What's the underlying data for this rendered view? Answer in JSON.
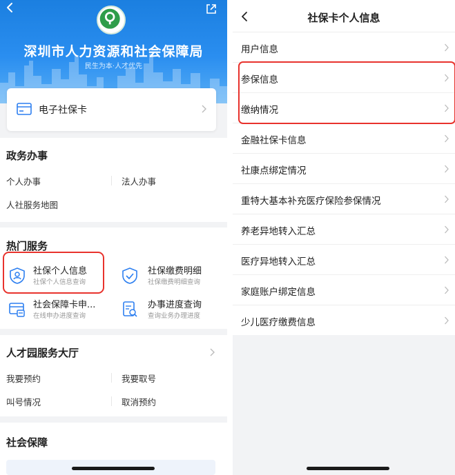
{
  "left": {
    "header": {
      "title": "深圳市人力资源和社会保障局",
      "subtitle": "民生为本·人才优先"
    },
    "e_card": {
      "label": "电子社保卡"
    },
    "gov_services": {
      "title": "政务办事",
      "items": [
        "个人办事",
        "法人办事",
        "人社服务地图"
      ]
    },
    "hot_services": {
      "title": "热门服务",
      "items": [
        {
          "title": "社保个人信息",
          "subtitle": "社保个人信息查询",
          "icon": "user-shield-icon"
        },
        {
          "title": "社保缴费明细",
          "subtitle": "社保缴费明细查询",
          "icon": "check-shield-icon"
        },
        {
          "title": "社会保障卡申...",
          "subtitle": "在线申办进度查询",
          "icon": "card-apply-icon"
        },
        {
          "title": "办事进度查询",
          "subtitle": "查询业务办理进度",
          "icon": "progress-query-icon"
        }
      ]
    },
    "talent_hall": {
      "title": "人才园服务大厅",
      "items": [
        "我要预约",
        "我要取号",
        "叫号情况",
        "取消预约"
      ]
    },
    "social_security": {
      "title": "社会保障"
    }
  },
  "right": {
    "header": {
      "title": "社保卡个人信息"
    },
    "rows": [
      "用户信息",
      "参保信息",
      "缴纳情况",
      "金融社保卡信息",
      "社康点绑定情况",
      "重特大基本补充医疗保险参保情况",
      "养老异地转入汇总",
      "医疗异地转入汇总",
      "家庭账户绑定信息",
      "少儿医疗缴费信息"
    ]
  },
  "colors": {
    "brand_blue": "#2a8ef0",
    "highlight_red": "#e8322c",
    "icon_blue": "#2d7ff0"
  }
}
